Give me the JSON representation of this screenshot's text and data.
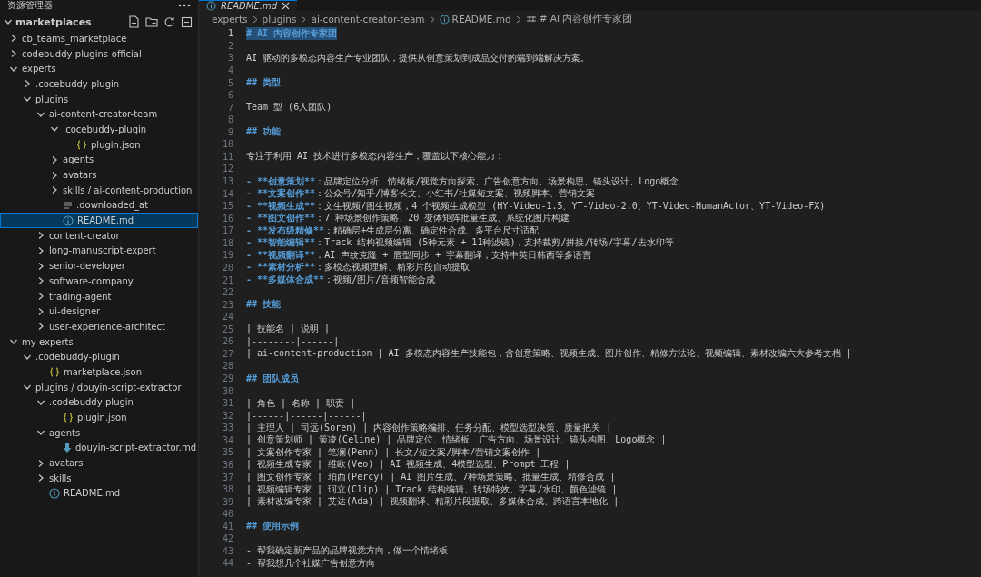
{
  "explorer": {
    "title": "资源管理器",
    "section": {
      "label": "marketplaces",
      "expanded": true,
      "items": [
        {
          "label": "cb_teams_marketplace",
          "kind": "folder",
          "expanded": false,
          "selected": false
        },
        {
          "label": "codebuddy-plugins-official",
          "kind": "folder",
          "expanded": false,
          "selected": false
        },
        {
          "label": "experts",
          "kind": "folder",
          "expanded": true,
          "selected": false,
          "children": [
            {
              "label": ".cocebuddy-plugin",
              "kind": "folder",
              "expanded": false,
              "selected": false
            },
            {
              "label": "plugins",
              "kind": "folder",
              "expanded": true,
              "selected": false,
              "children": [
                {
                  "label": "ai-content-creator-team",
                  "kind": "folder",
                  "expanded": true,
                  "selected": false,
                  "children": [
                    {
                      "label": ".cocebuddy-plugin",
                      "kind": "folder",
                      "expanded": true,
                      "selected": false,
                      "children": [
                        {
                          "label": "plugin.json",
                          "kind": "json",
                          "selected": false
                        }
                      ]
                    },
                    {
                      "label": "agents",
                      "kind": "folder",
                      "expanded": false,
                      "selected": false
                    },
                    {
                      "label": "avatars",
                      "kind": "folder",
                      "expanded": false,
                      "selected": false
                    },
                    {
                      "label": "skills / ai-content-production",
                      "kind": "folder",
                      "expanded": false,
                      "selected": false
                    },
                    {
                      "label": ".downloaded_at",
                      "kind": "text",
                      "selected": false
                    },
                    {
                      "label": "README.md",
                      "kind": "readme",
                      "selected": true
                    }
                  ]
                },
                {
                  "label": "content-creator",
                  "kind": "folder",
                  "expanded": false,
                  "selected": false
                },
                {
                  "label": "long-manuscript-expert",
                  "kind": "folder",
                  "expanded": false,
                  "selected": false
                },
                {
                  "label": "senior-developer",
                  "kind": "folder",
                  "expanded": false,
                  "selected": false
                },
                {
                  "label": "software-company",
                  "kind": "folder",
                  "expanded": false,
                  "selected": false
                },
                {
                  "label": "trading-agent",
                  "kind": "folder",
                  "expanded": false,
                  "selected": false
                },
                {
                  "label": "ui-designer",
                  "kind": "folder",
                  "expanded": false,
                  "selected": false
                },
                {
                  "label": "user-experience-architect",
                  "kind": "folder",
                  "expanded": false,
                  "selected": false
                }
              ]
            }
          ]
        },
        {
          "label": "my-experts",
          "kind": "folder",
          "expanded": true,
          "selected": false,
          "children": [
            {
              "label": ".codebuddy-plugin",
              "kind": "folder",
              "expanded": true,
              "selected": false,
              "children": [
                {
                  "label": "marketplace.json",
                  "kind": "json",
                  "selected": false
                }
              ]
            },
            {
              "label": "plugins / douyin-script-extractor",
              "kind": "folder",
              "expanded": true,
              "selected": false,
              "children": [
                {
                  "label": ".codebuddy-plugin",
                  "kind": "folder",
                  "expanded": true,
                  "selected": false,
                  "children": [
                    {
                      "label": "plugin.json",
                      "kind": "json",
                      "selected": false
                    }
                  ]
                },
                {
                  "label": "agents",
                  "kind": "folder",
                  "expanded": true,
                  "selected": false,
                  "children": [
                    {
                      "label": "douyin-script-extractor.md",
                      "kind": "markdown",
                      "selected": false
                    }
                  ]
                },
                {
                  "label": "avatars",
                  "kind": "folder",
                  "expanded": false,
                  "selected": false
                },
                {
                  "label": "skills",
                  "kind": "folder",
                  "expanded": false,
                  "selected": false
                },
                {
                  "label": "README.md",
                  "kind": "readme",
                  "selected": false
                }
              ]
            }
          ]
        }
      ]
    }
  },
  "tab": {
    "label": "README.md"
  },
  "breadcrumb": [
    {
      "label": "experts",
      "kind": "folder"
    },
    {
      "label": "plugins",
      "kind": "folder"
    },
    {
      "label": "ai-content-creator-team",
      "kind": "folder"
    },
    {
      "label": "README.md",
      "kind": "readme"
    },
    {
      "label": "# AI 内容创作专家团",
      "kind": "symbol"
    }
  ],
  "editor": {
    "lines": [
      {
        "n": "1",
        "kind": "heading",
        "text": "# AI 内容创作专家团",
        "current": true
      },
      {
        "n": "2",
        "kind": "blank",
        "current": false
      },
      {
        "n": "3",
        "kind": "plain",
        "text": "AI 驱动的多模态内容生产专业团队，提供从创意策划到成品交付的端到端解决方案。",
        "current": false
      },
      {
        "n": "4",
        "kind": "blank",
        "current": false
      },
      {
        "n": "5",
        "kind": "heading",
        "text": "## 类型",
        "current": false
      },
      {
        "n": "6",
        "kind": "blank",
        "current": false
      },
      {
        "n": "7",
        "kind": "plain",
        "text": "Team 型 (6人团队)",
        "current": false
      },
      {
        "n": "8",
        "kind": "blank",
        "current": false
      },
      {
        "n": "9",
        "kind": "heading",
        "text": "## 功能",
        "current": false
      },
      {
        "n": "10",
        "kind": "blank",
        "current": false
      },
      {
        "n": "11",
        "kind": "plain",
        "text": "专注于利用 AI 技术进行多模态内容生产，覆盖以下核心能力：",
        "current": false
      },
      {
        "n": "12",
        "kind": "blank",
        "current": false
      },
      {
        "n": "13",
        "kind": "bullet",
        "marker": "- **创意策划**",
        "text": "：品牌定位分析、情绪板/视觉方向探索、广告创意方向、场景构思、镜头设计、Logo概念",
        "current": false
      },
      {
        "n": "14",
        "kind": "bullet",
        "marker": "- **文案创作**",
        "text": "：公众号/知乎/博客长文、小红书/社媒短文案、视频脚本、营销文案",
        "current": false
      },
      {
        "n": "15",
        "kind": "bullet",
        "marker": "- **视频生成**",
        "text": "：文生视频/图生视频，4 个视频生成模型 (HY-Video-1.5、YT-Video-2.0、YT-Video-HumanActor、YT-Video-FX)",
        "current": false
      },
      {
        "n": "16",
        "kind": "bullet",
        "marker": "- **图文创作**",
        "text": "：7 种场景创作策略、20 变体矩阵批量生成、系统化图片构建",
        "current": false
      },
      {
        "n": "17",
        "kind": "bullet",
        "marker": "- **发布级精修**",
        "text": "：精确层+生成层分离、确定性合成、多平台尺寸适配",
        "current": false
      },
      {
        "n": "18",
        "kind": "bullet",
        "marker": "- **智能编辑**",
        "text": "：Track 结构视频编辑 (5种元素 + 11种滤镜)，支持裁剪/拼接/转场/字幕/去水印等",
        "current": false
      },
      {
        "n": "19",
        "kind": "bullet",
        "marker": "- **视频翻译**",
        "text": "：AI 声纹克隆 + 唇型同步 + 字幕翻译，支持中英日韩西等多语言",
        "current": false
      },
      {
        "n": "20",
        "kind": "bullet",
        "marker": "- **素材分析**",
        "text": "：多模态视频理解、精彩片段自动提取",
        "current": false
      },
      {
        "n": "21",
        "kind": "bullet",
        "marker": "- **多媒体合成**",
        "text": "：视频/图片/音频智能合成",
        "current": false
      },
      {
        "n": "22",
        "kind": "blank",
        "current": false
      },
      {
        "n": "23",
        "kind": "heading",
        "text": "## 技能",
        "current": false
      },
      {
        "n": "24",
        "kind": "blank",
        "current": false
      },
      {
        "n": "25",
        "kind": "plain",
        "text": "| 技能名 | 说明 |",
        "current": false
      },
      {
        "n": "26",
        "kind": "plain",
        "text": "|--------|------|",
        "current": false
      },
      {
        "n": "27",
        "kind": "plain",
        "text": "| ai-content-production | AI 多模态内容生产技能包，含创意策略、视频生成、图片创作、精修方法论、视频编辑、素材改编六大参考文档 |",
        "current": false
      },
      {
        "n": "28",
        "kind": "blank",
        "current": false
      },
      {
        "n": "29",
        "kind": "heading",
        "text": "## 团队成员",
        "current": false
      },
      {
        "n": "30",
        "kind": "blank",
        "current": false
      },
      {
        "n": "31",
        "kind": "plain",
        "text": "| 角色 | 名称 | 职责 |",
        "current": false
      },
      {
        "n": "32",
        "kind": "plain",
        "text": "|------|------|------|",
        "current": false
      },
      {
        "n": "33",
        "kind": "plain",
        "text": "| 主理人 | 司远(Soren) | 内容创作策略编排、任务分配、模型选型决策、质量把关 |",
        "current": false
      },
      {
        "n": "34",
        "kind": "plain",
        "text": "| 创意策划师 | 策凌(Celine) | 品牌定位、情绪板、广告方向、场景设计、镜头构图、Logo概念 |",
        "current": false
      },
      {
        "n": "35",
        "kind": "plain",
        "text": "| 文案创作专家 | 笔澜(Penn) | 长文/短文案/脚本/营销文案创作 |",
        "current": false
      },
      {
        "n": "36",
        "kind": "plain",
        "text": "| 视频生成专家 | 维欧(Veo) | AI 视频生成、4模型选型、Prompt 工程 |",
        "current": false
      },
      {
        "n": "37",
        "kind": "plain",
        "text": "| 图文创作专家 | 珀西(Percy) | AI 图片生成、7种场景策略、批量生成、精修合成 |",
        "current": false
      },
      {
        "n": "38",
        "kind": "plain",
        "text": "| 视频编辑专家 | 珂立(Clip) | Track 结构编辑、转场特效、字幕/水印、颜色滤镜 |",
        "current": false
      },
      {
        "n": "39",
        "kind": "plain",
        "text": "| 素材改编专家 | 艾达(Ada) | 视频翻译、精彩片段提取、多媒体合成、跨语言本地化 |",
        "current": false
      },
      {
        "n": "40",
        "kind": "blank",
        "current": false
      },
      {
        "n": "41",
        "kind": "heading",
        "text": "## 使用示例",
        "current": false
      },
      {
        "n": "42",
        "kind": "blank",
        "current": false
      },
      {
        "n": "43",
        "kind": "plain",
        "text": "- 帮我确定新产品的品牌视觉方向，做一个情绪板",
        "current": false
      },
      {
        "n": "44",
        "kind": "plain",
        "text": "- 帮我想几个社媒广告创意方向",
        "current": false
      }
    ]
  }
}
